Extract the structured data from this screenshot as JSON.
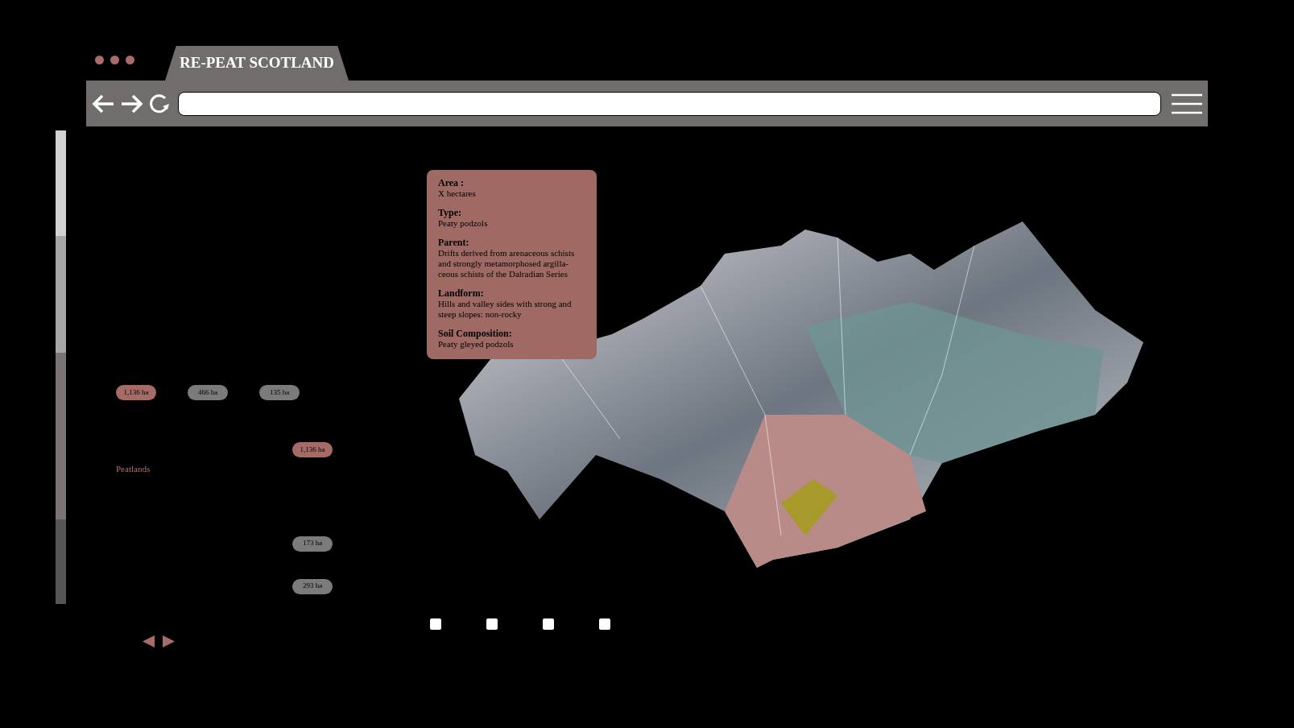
{
  "tab": {
    "title": "RE-PEAT SCOTLAND"
  },
  "badges_row": [
    {
      "label": "1,136 ha",
      "color": "#a66b67"
    },
    {
      "label": "466 ha",
      "color": "#7b7b7b"
    },
    {
      "label": "135 ha",
      "color": "#7b7b7b"
    }
  ],
  "peatlands": {
    "label": "Peatlands",
    "badge": {
      "label": "1,136 ha",
      "color": "#a66b67"
    }
  },
  "badges_column": [
    {
      "label": "173 ha",
      "color": "#7b7b7b"
    },
    {
      "label": "293 ha",
      "color": "#7b7b7b"
    }
  ],
  "info_card": {
    "sections": [
      {
        "heading": "Area :",
        "text": "X hectares"
      },
      {
        "heading": "Type:",
        "text": "Peaty podzols"
      },
      {
        "heading": "Parent:",
        "text": "Drifts derived from arenaceous schists and strongly metamorphosed argilla-ceous schists of the Dalradian Series"
      },
      {
        "heading": "Landform:",
        "text": "Hills and valley sides with strong and steep slopes: non-rocky"
      },
      {
        "heading": "Soil Composition:",
        "text": "Peaty gleyed podzols"
      }
    ]
  }
}
